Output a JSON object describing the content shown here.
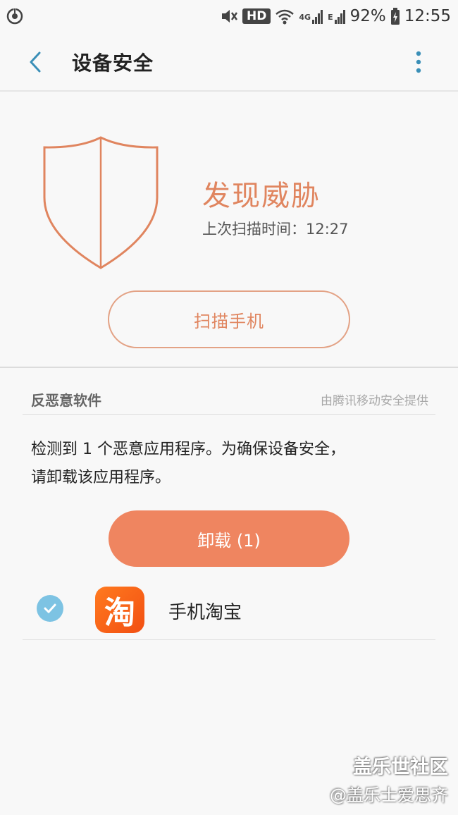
{
  "status_bar": {
    "hd_badge": "HD",
    "network_4g": "4G",
    "network_e": "E",
    "battery": "92%",
    "time": "12:55"
  },
  "header": {
    "title": "设备安全"
  },
  "status_card": {
    "headline": "发现威胁",
    "last_scan": "上次扫描时间：12:27",
    "scan_button": "扫描手机"
  },
  "anti_malware": {
    "section_title": "反恶意软件",
    "provider": "由腾讯移动安全提供",
    "message_line1": "检测到 1 个恶意应用程序。为确保设备安全，",
    "message_line2": "请卸载该应用程序。",
    "uninstall_button": "卸载 (1)",
    "apps": [
      {
        "name": "手机淘宝",
        "icon_char": "淘",
        "selected": true
      }
    ]
  },
  "watermark": {
    "title": "盖乐世社区",
    "credit": "@盖乐士爱思齐"
  },
  "colors": {
    "accent": "#e0855f",
    "button_fill": "#ef8560",
    "check": "#7dc3e3",
    "back_arrow": "#3a8fb7"
  }
}
